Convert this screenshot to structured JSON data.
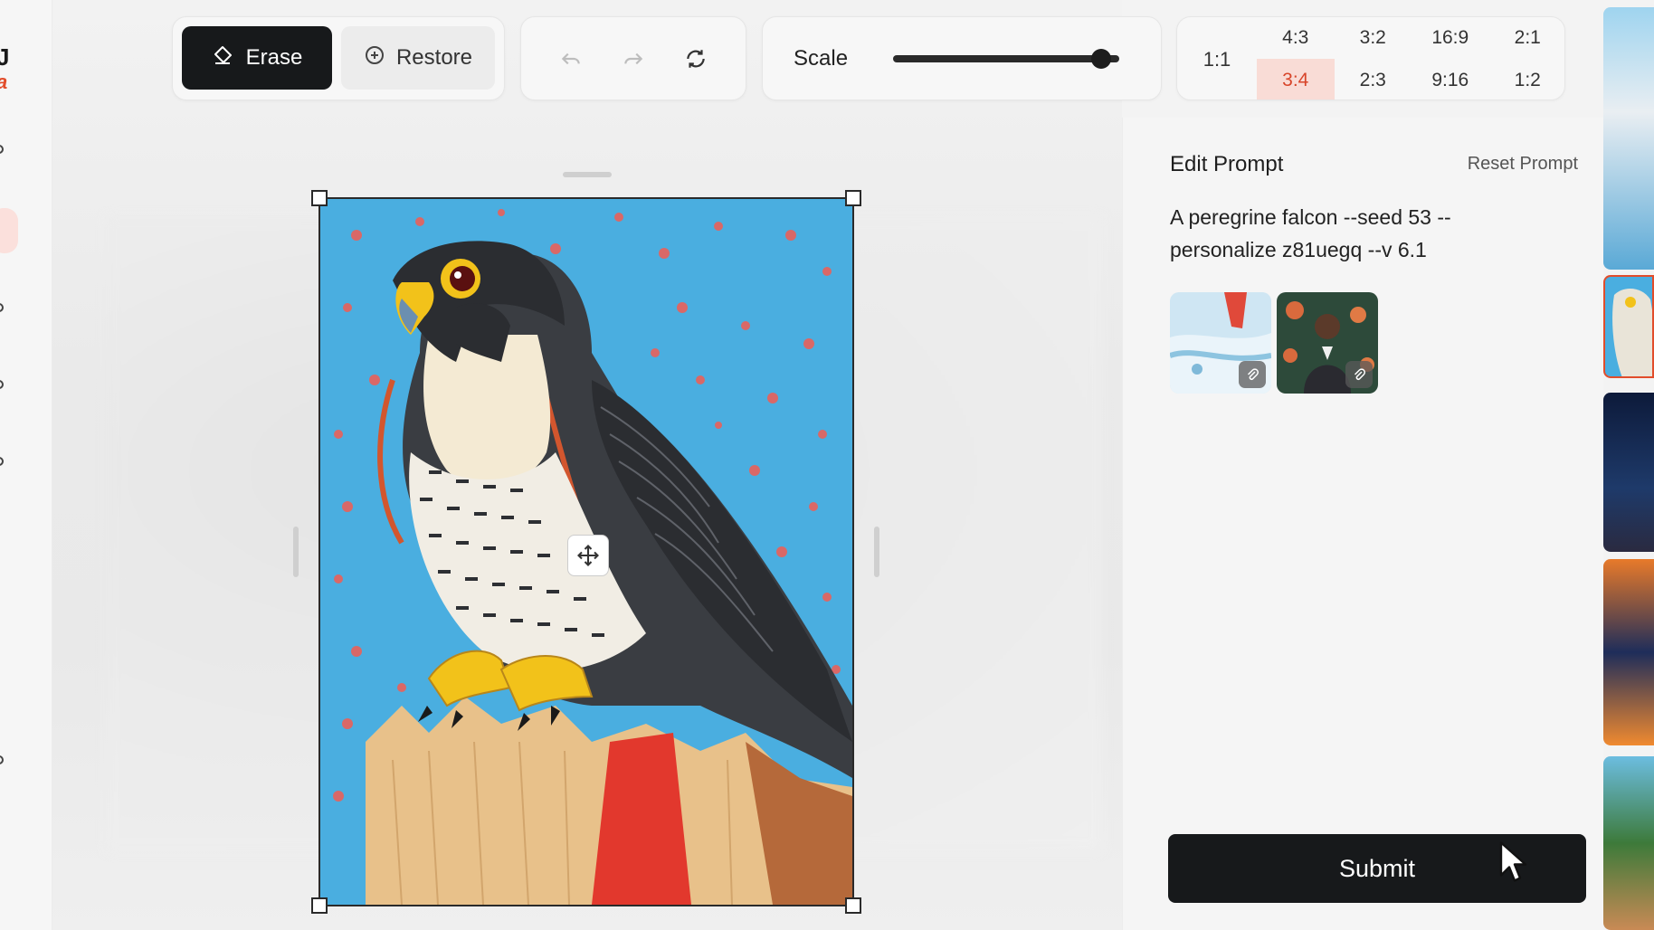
{
  "sidebar": {
    "logo_top": "J",
    "logo_bottom": "a"
  },
  "toolbar": {
    "erase_label": "Erase",
    "restore_label": "Restore",
    "scale_label": "Scale",
    "scale_value": 0.96,
    "aspect_ratios": {
      "square": "1:1",
      "options": [
        "4:3",
        "3:2",
        "16:9",
        "2:1",
        "3:4",
        "2:3",
        "9:16",
        "1:2"
      ],
      "selected": "3:4"
    }
  },
  "panel": {
    "title": "Edit Prompt",
    "reset_label": "Reset Prompt",
    "prompt": "A peregrine falcon --seed 53 --personalize z81uegq --v 6.1",
    "submit_label": "Submit"
  },
  "colors": {
    "accent": "#d8452a",
    "accent_bg": "#f9dcd6",
    "dark_button": "#17191b",
    "sky": "#4aaee0"
  }
}
